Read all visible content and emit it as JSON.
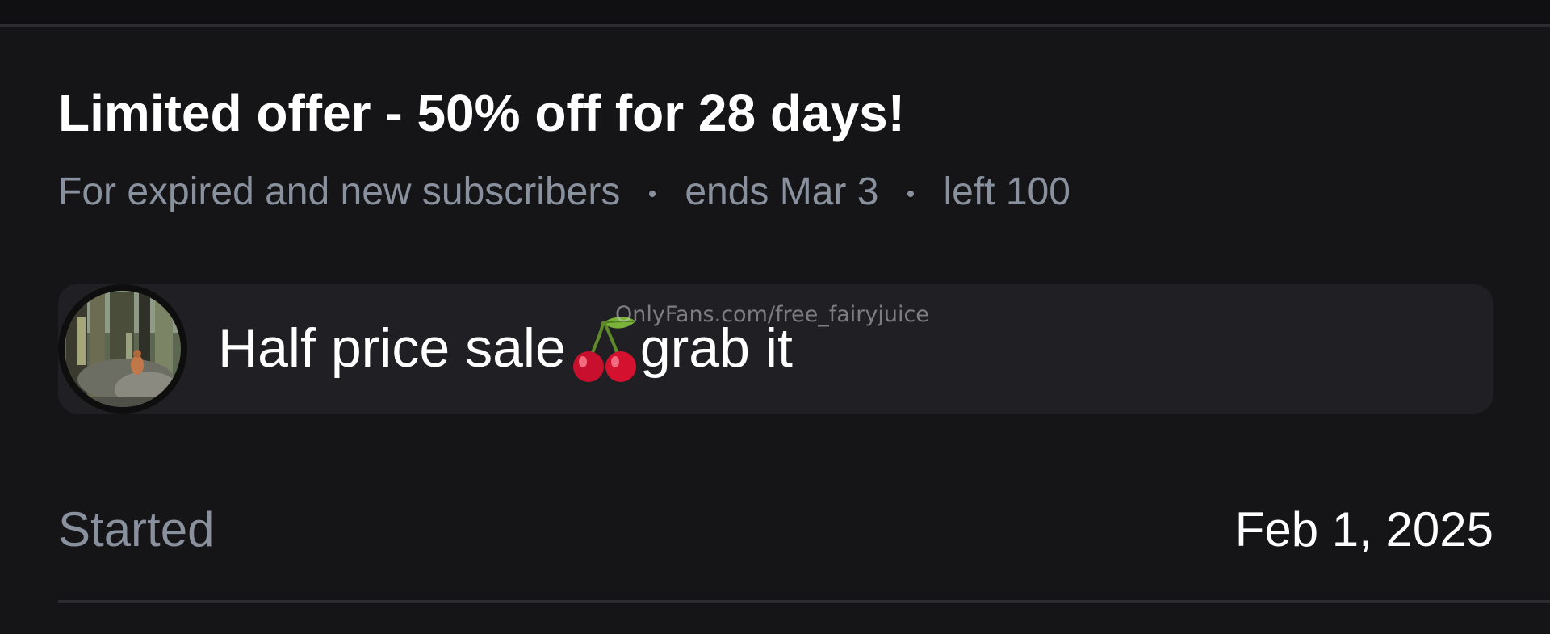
{
  "offer": {
    "title": "Limited offer - 50% off for 28 days!",
    "audience": "For expired and new subscribers",
    "ends": "ends Mar 3",
    "left": "left 100"
  },
  "message": {
    "text_before": "Half price sale",
    "emoji_icon": "cherry-icon",
    "text_after": "grab it",
    "avatar_icon": "avatar-forest-photo"
  },
  "watermark": {
    "text": "OnlyFans.com/free_fairyjuice"
  },
  "started": {
    "label": "Started",
    "date": "Feb 1, 2025"
  },
  "colors": {
    "background": "#151517",
    "card": "#202024",
    "primary_text": "#ffffff",
    "secondary_text": "#8a919e",
    "divider": "#2c2d31"
  }
}
